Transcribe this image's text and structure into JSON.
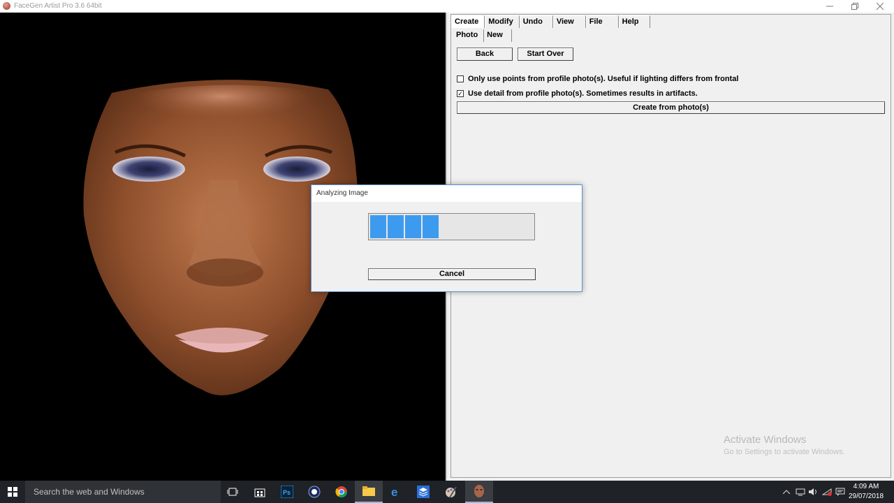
{
  "window": {
    "title": "FaceGen Artist Pro 3.6 64bit"
  },
  "menu_tabs": [
    "Create",
    "Modify",
    "Undo",
    "View",
    "File",
    "Help"
  ],
  "sub_tabs": [
    "Photo",
    "New"
  ],
  "buttons": {
    "back": "Back",
    "start_over": "Start Over",
    "create_from_photos": "Create from photo(s)"
  },
  "options": [
    {
      "label": "Only use points from profile photo(s). Useful if lighting differs from frontal",
      "checked": false
    },
    {
      "label": "Use detail from profile photo(s). Sometimes results in artifacts.",
      "checked": true
    }
  ],
  "dialog": {
    "title": "Analyzing Image",
    "cancel_label": "Cancel",
    "progress_segments": 4
  },
  "watermark": {
    "line1": "Activate Windows",
    "line2": "Go to Settings to activate Windows."
  },
  "taskbar": {
    "search_placeholder": "Search the web and Windows",
    "time": "4:09 AM",
    "date": "29/07/2018"
  },
  "colors": {
    "progress": "#3d9bef",
    "taskbar": "#1f2226",
    "viewport_bg": "#000000"
  }
}
